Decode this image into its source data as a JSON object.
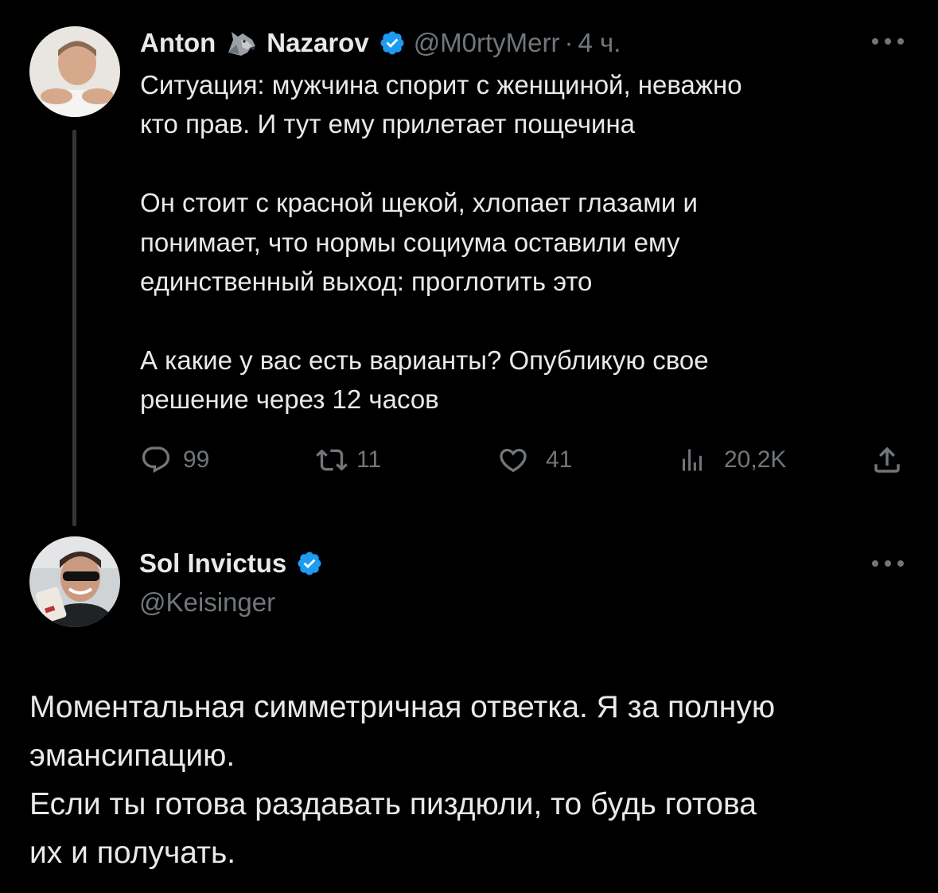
{
  "tweet1": {
    "author_name_first": "Anton",
    "author_name_last": "Nazarov",
    "handle": "@M0rtyMerr",
    "separator": "·",
    "time": "4 ч.",
    "text_lines": [
      "Ситуация: мужчина спорит с женщиной, неважно",
      "кто прав. И тут ему прилетает пощечина",
      "",
      "Он стоит с красной щекой, хлопает глазами и",
      "понимает, что нормы социума оставили ему",
      "единственный выход: проглотить это",
      "",
      "А какие у вас есть варианты? Опубликую свое",
      "решение через 12 часов"
    ],
    "stats": {
      "replies": "99",
      "retweets": "11",
      "likes": "41",
      "views": "20,2K"
    }
  },
  "tweet2": {
    "author_name": "Sol Invictus",
    "handle": "@Keisinger",
    "text_lines": [
      "Моментальная симметричная ответка. Я за полную",
      "эмансипацию.",
      "Если ты готова раздавать пиздюли, то будь готова",
      "их и получать."
    ]
  },
  "colors": {
    "background": "#000000",
    "text": "#e7e9ea",
    "secondary": "#71767b",
    "verified": "#1d9bf0",
    "thread_line": "#333639"
  },
  "icons": [
    "wolf-icon",
    "verified-icon",
    "more-icon",
    "reply-icon",
    "retweet-icon",
    "like-icon",
    "views-icon",
    "share-icon"
  ]
}
